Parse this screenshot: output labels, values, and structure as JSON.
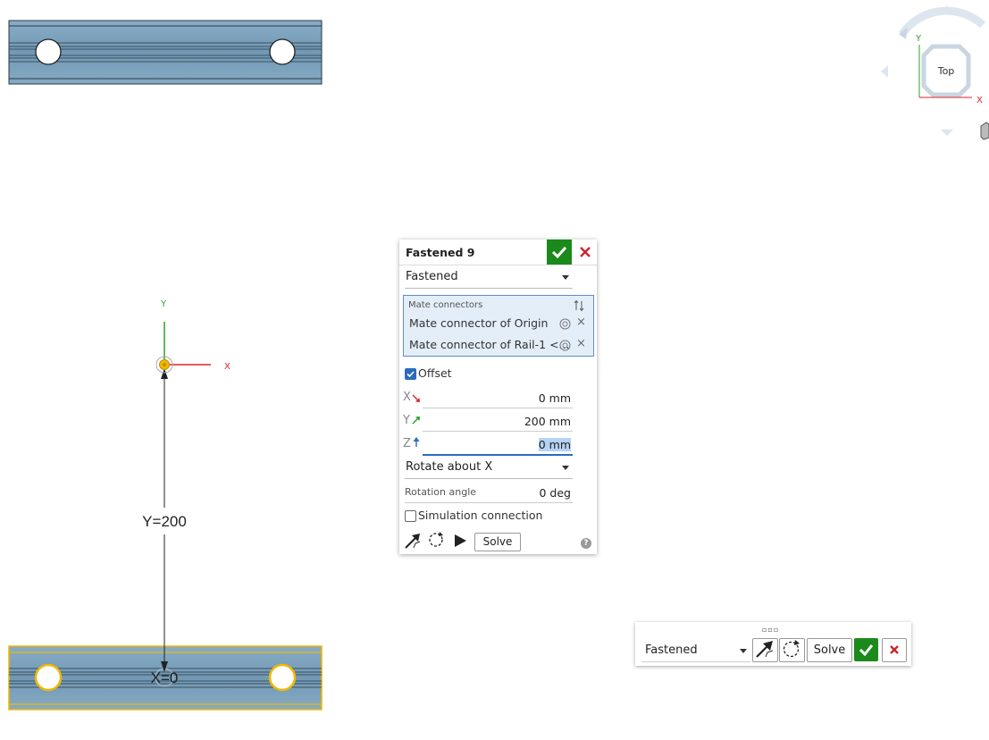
{
  "viewport": {
    "dimension_label": "Y=200",
    "x_label": "X=0",
    "triad_x": "X",
    "triad_y": "Y",
    "view_cube": {
      "face": "Top",
      "x": "X",
      "y": "Y"
    }
  },
  "dialog": {
    "title": "Fastened 9",
    "mate_type": "Fastened",
    "mate_connectors": {
      "header": "Mate connectors",
      "items": [
        "Mate connector of Origin",
        "Mate connector of Rail-1 <..."
      ]
    },
    "offset_label": "Offset",
    "offset_checked": true,
    "offsets": [
      {
        "axis": "X",
        "value": "0 mm"
      },
      {
        "axis": "Y",
        "value": "200 mm"
      },
      {
        "axis": "Z",
        "value": "0 mm"
      }
    ],
    "rotate_option": "Rotate about X",
    "rotation_angle_label": "Rotation angle",
    "rotation_angle_value": "0 deg",
    "simulation_label": "Simulation connection",
    "simulation_checked": false,
    "solve_label": "Solve"
  },
  "mini_toolbar": {
    "mate_type": "Fastened",
    "solve_label": "Solve"
  },
  "colors": {
    "rail_fill": "#7aa2bd",
    "highlight": "#f0b800",
    "x_axis": "#d9262c",
    "y_axis": "#2ca02c",
    "accept": "#1b8a1b",
    "selection": "#5b8fc7"
  }
}
